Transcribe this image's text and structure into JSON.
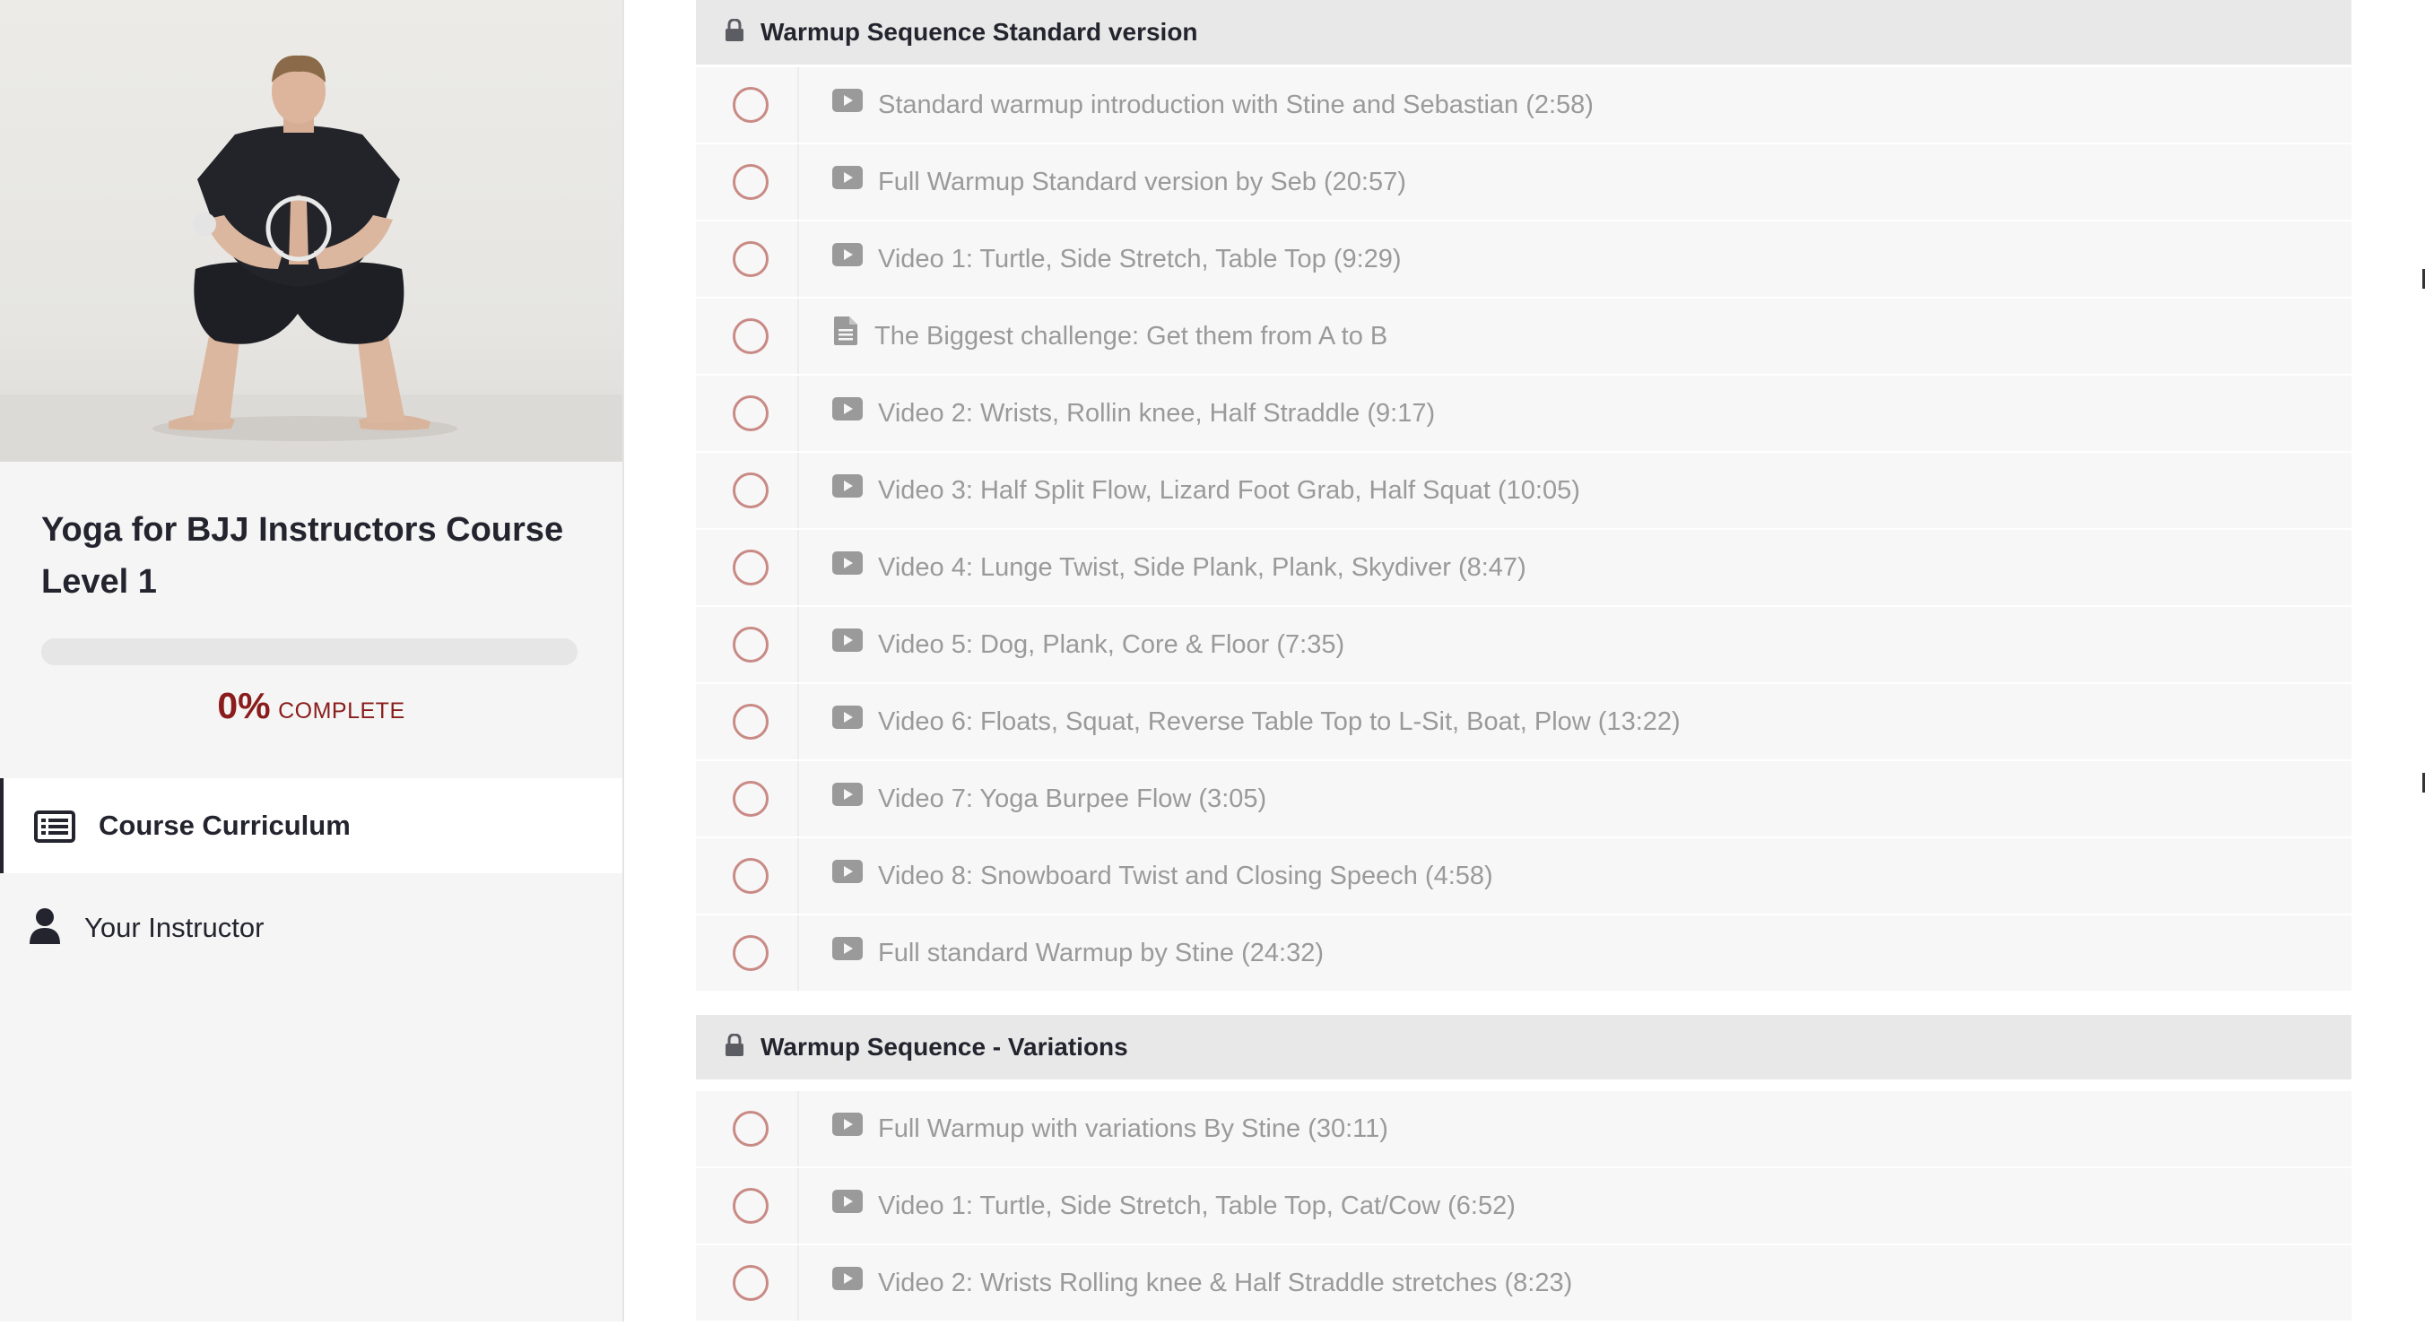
{
  "sidebar": {
    "course_title": "Yoga for BJJ Instructors Course Level 1",
    "progress": {
      "percent_value": 0,
      "percent_label": "0%",
      "complete_label": "COMPLETE"
    },
    "nav": [
      {
        "label": "Course Curriculum",
        "icon": "list-icon",
        "active": true
      },
      {
        "label": "Your Instructor",
        "icon": "user-icon",
        "active": false
      }
    ]
  },
  "sections": [
    {
      "title": "Warmup Sequence Standard version",
      "icon": "lock-icon",
      "lessons": [
        {
          "type": "video",
          "title": "Standard warmup introduction with Stine and Sebastian (2:58)"
        },
        {
          "type": "video",
          "title": "Full Warmup Standard version by Seb (20:57)"
        },
        {
          "type": "video",
          "title": "Video 1: Turtle, Side Stretch, Table Top (9:29)"
        },
        {
          "type": "text",
          "title": "The Biggest challenge: Get them from A to B"
        },
        {
          "type": "video",
          "title": "Video 2: Wrists, Rollin knee, Half Straddle (9:17)"
        },
        {
          "type": "video",
          "title": "Video 3: Half Split Flow, Lizard Foot Grab, Half Squat (10:05)"
        },
        {
          "type": "video",
          "title": "Video 4: Lunge Twist, Side Plank, Plank, Skydiver (8:47)"
        },
        {
          "type": "video",
          "title": "Video 5: Dog, Plank, Core & Floor (7:35)"
        },
        {
          "type": "video",
          "title": "Video 6: Floats, Squat, Reverse Table Top to L-Sit, Boat, Plow (13:22)"
        },
        {
          "type": "video",
          "title": "Video 7: Yoga Burpee Flow (3:05)"
        },
        {
          "type": "video",
          "title": "Video 8: Snowboard Twist and Closing Speech (4:58)"
        },
        {
          "type": "video",
          "title": "Full standard Warmup by Stine (24:32)"
        }
      ]
    },
    {
      "title": "Warmup Sequence - Variations",
      "icon": "lock-icon",
      "lessons": [
        {
          "type": "video",
          "title": "Full Warmup with variations By Stine (30:11)"
        },
        {
          "type": "video",
          "title": "Video 1: Turtle, Side Stretch, Table Top, Cat/Cow (6:52)"
        },
        {
          "type": "video",
          "title": "Video 2: Wrists Rolling knee & Half Straddle stretches (8:23)"
        }
      ]
    }
  ],
  "colors": {
    "accent": "#8a1c1c",
    "check_ring": "#c98a85",
    "lesson_text": "#9a9a9a",
    "heading_text": "#23242e"
  }
}
